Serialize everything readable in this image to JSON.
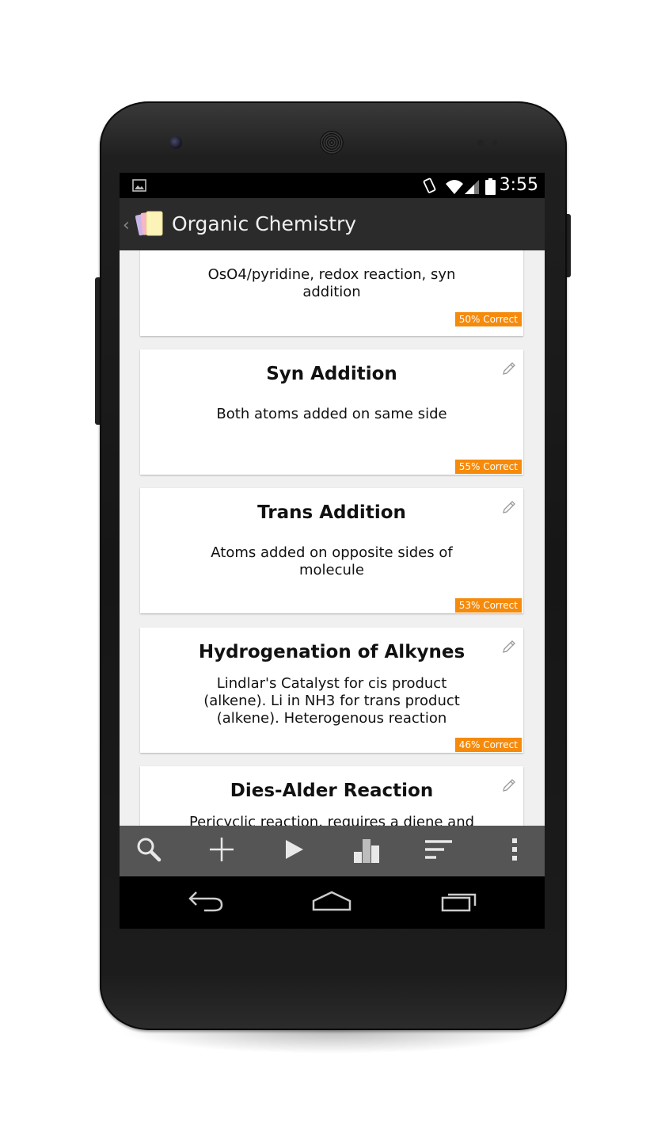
{
  "status_bar": {
    "time": "3:55"
  },
  "action_bar": {
    "title": "Organic Chemistry",
    "up_caret": "‹"
  },
  "cards": [
    {
      "term": "",
      "definition": "OsO4/pyridine, redox reaction, syn addition",
      "badge": "50% Correct"
    },
    {
      "term": "Syn Addition",
      "definition": "Both atoms added on same side",
      "badge": "55% Correct"
    },
    {
      "term": "Trans Addition",
      "definition": "Atoms added on opposite sides of molecule",
      "badge": "53% Correct"
    },
    {
      "term": "Hydrogenation of Alkynes",
      "definition": "Lindlar's Catalyst for cis product (alkene). Li in NH3 for trans product (alkene). Heterogenous reaction",
      "badge": "46% Correct"
    },
    {
      "term": "Dies-Alder Reaction",
      "definition": "Pericyclic reaction, requires a diene and a",
      "badge": ""
    }
  ],
  "bottom_toolbar": [
    "search-icon",
    "add-icon",
    "play-icon",
    "stats-icon",
    "sort-icon",
    "overflow-menu-icon"
  ],
  "nav_bar": [
    "back-icon",
    "home-icon",
    "recents-icon"
  ],
  "colors": {
    "badge": "#f58a0b",
    "action_bar": "#2b2b2b",
    "toolbar": "#555555"
  }
}
